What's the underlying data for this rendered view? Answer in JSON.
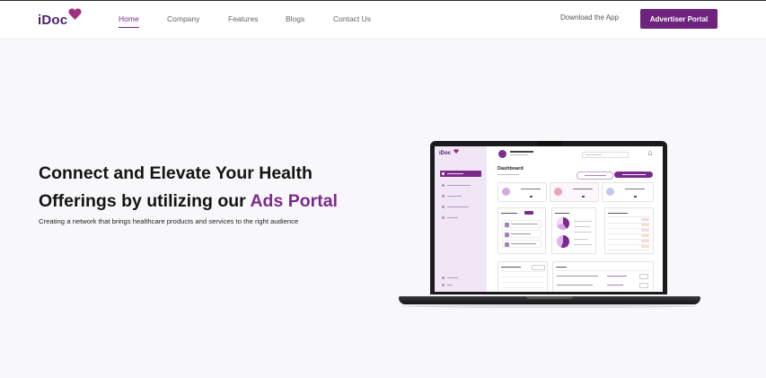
{
  "nav": {
    "logo_text": "iDoc",
    "links": [
      {
        "label": "Home",
        "active": true
      },
      {
        "label": "Company",
        "active": false
      },
      {
        "label": "Features",
        "active": false
      },
      {
        "label": "Blogs",
        "active": false
      },
      {
        "label": "Contact Us",
        "active": false
      }
    ],
    "download_label": "Download the App",
    "portal_button": "Advertiser Portal"
  },
  "hero": {
    "title_line1": "Connect and Elevate Your Health",
    "title_line2_prefix": "Offerings by utilizing our ",
    "title_accent": "Ads Portal",
    "subtitle": "Creating a network that brings healthcare products and services to the right audience"
  },
  "colors": {
    "brand": "#6e237e",
    "accent": "#7b2a8c",
    "logo": "#4a1f6e",
    "heart": "#a0307f",
    "hero_bg": "#f8f8fa"
  },
  "mock_dashboard": {
    "logo_text": "iDoc",
    "title": "Dashboard"
  }
}
